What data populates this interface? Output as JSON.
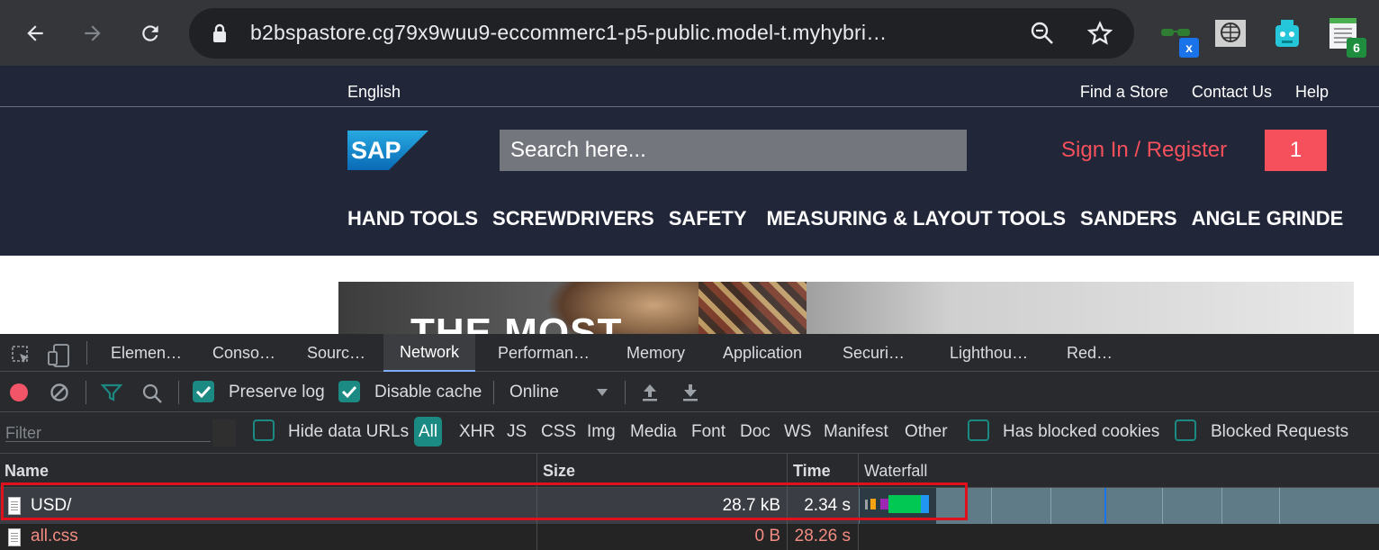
{
  "browser": {
    "url": "b2bspastore.cg79x9wuu9-eccommerc1-p5-public.model-t.myhybri…",
    "extensions": [
      {
        "icon": "glasses-extension-icon",
        "badge": "x",
        "badge_color": "#1a73e8"
      },
      {
        "icon": "globe-extension-icon",
        "badge": ""
      },
      {
        "icon": "robot-extension-icon",
        "badge": ""
      },
      {
        "icon": "window-extension-icon",
        "badge": "6",
        "badge_color": "#1e8e3e"
      }
    ]
  },
  "site": {
    "language": "English",
    "top_links": [
      "Find a Store",
      "Contact Us",
      "Help"
    ],
    "logo_text": "SAP",
    "search_placeholder": "Search here...",
    "signin": "Sign In / Register",
    "cart_count": "1",
    "categories": [
      "HAND TOOLS",
      "SCREWDRIVERS",
      "SAFETY",
      "MEASURING & LAYOUT TOOLS",
      "SANDERS",
      "ANGLE GRINDE"
    ],
    "hero_text": "THE MOST",
    "accent": "#f5505b"
  },
  "devtools": {
    "tabs": [
      "Elemen…",
      "Conso…",
      "Sourc…",
      "Network",
      "Performan…",
      "Memory",
      "Application",
      "Securi…",
      "Lighthou…",
      "Red…"
    ],
    "active_tab": "Network",
    "toolbar": {
      "preserve_log": "Preserve log",
      "disable_cache": "Disable cache",
      "throttle": "Online"
    },
    "filter": {
      "placeholder": "Filter",
      "hide_data_urls": "Hide data URLs",
      "types": [
        "All",
        "XHR",
        "JS",
        "CSS",
        "Img",
        "Media",
        "Font",
        "Doc",
        "WS",
        "Manifest",
        "Other"
      ],
      "has_blocked_cookies": "Has blocked cookies",
      "blocked_requests": "Blocked Requests"
    },
    "columns": [
      "Name",
      "Size",
      "Time",
      "Waterfall"
    ],
    "rows": [
      {
        "name": "USD/",
        "size": "28.7 kB",
        "time": "2.34 s",
        "color": "#ffffff"
      },
      {
        "name": "all.css",
        "size": "0 B",
        "time": "28.26 s",
        "color": "#f28b82"
      }
    ],
    "accent": "#1a8a82"
  }
}
